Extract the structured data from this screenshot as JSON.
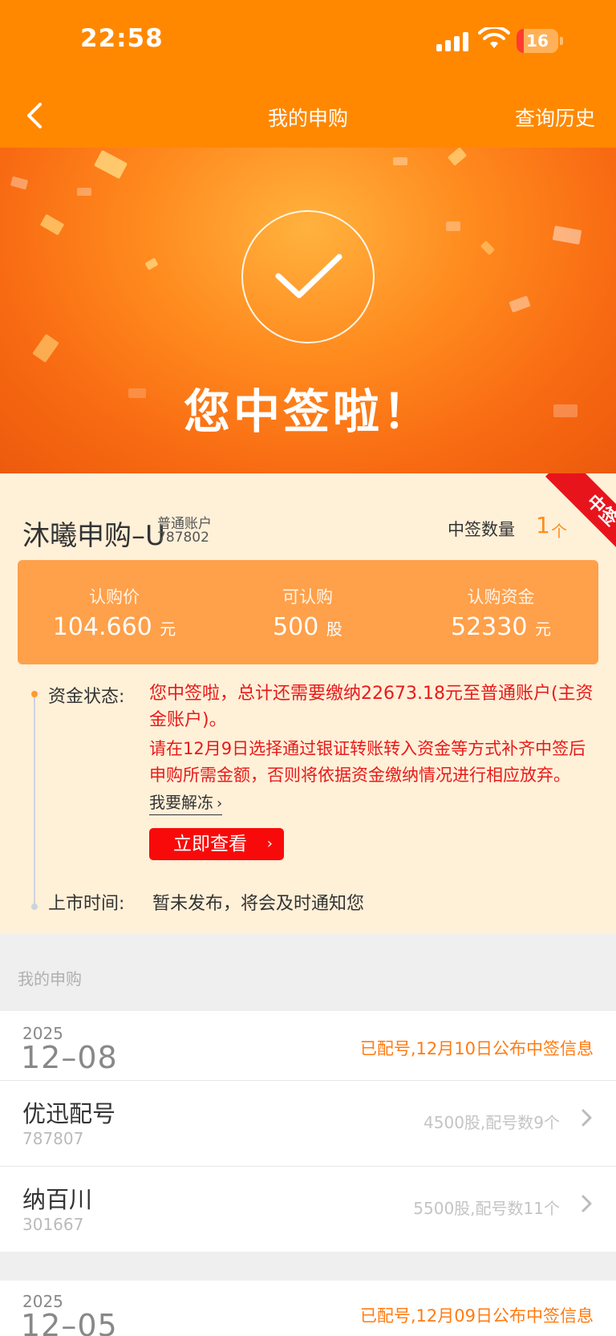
{
  "status_bar": {
    "time": "22:58",
    "battery": "16",
    "icons": [
      "signal-icon",
      "wifi-icon",
      "battery-icon"
    ]
  },
  "nav": {
    "title": "我的申购",
    "history": "查询历史",
    "back_icon": "chevron-left-icon"
  },
  "banner": {
    "title": "您中签啦！",
    "icon": "checkmark-icon"
  },
  "detail": {
    "ribbon": "中签",
    "stock_name": "沐曦申购–U",
    "account_type": "普通账户",
    "account_code": "787802",
    "quantity_label": "中签数量",
    "quantity_value": "1",
    "quantity_unit": "个",
    "stats": [
      {
        "label": "认购价",
        "value": "104.660",
        "unit": "元"
      },
      {
        "label": "可认购",
        "value": "500",
        "unit": "股"
      },
      {
        "label": "认购资金",
        "value": "52330",
        "unit": "元"
      }
    ],
    "fund_label": "资金状态:",
    "fund_text": "您中签啦，总计还需要缴纳22673.18元至普通账户(主资金账户)。",
    "fund_text2": "请在12月9日选择通过银证转账转入资金等方式补齐中签后申购所需金额，否则将依据资金缴纳情况进行相应放弃。",
    "unfreeze": "我要解冻",
    "view_button": "立即查看",
    "listing_label": "上市时间:",
    "listing_text": "暂未发布，将会及时通知您"
  },
  "records_header": "我的申购",
  "records": [
    {
      "year": "2025",
      "date": "12–08",
      "note": "已配号,12月10日公布中签信息",
      "items": [
        {
          "name": "优迅配号",
          "code": "787807",
          "info": "4500股,配号数9个"
        },
        {
          "name": "纳百川",
          "code": "301667",
          "info": "5500股,配号数11个"
        }
      ]
    },
    {
      "year": "2025",
      "date": "12–05",
      "note": "已配号,12月09日公布中签信息",
      "items": []
    }
  ],
  "colors": {
    "brand_orange": "#ff8800",
    "accent_red": "#e81a1a",
    "stats_bg": "#ffa04a",
    "detail_bg": "#fff0d8"
  }
}
